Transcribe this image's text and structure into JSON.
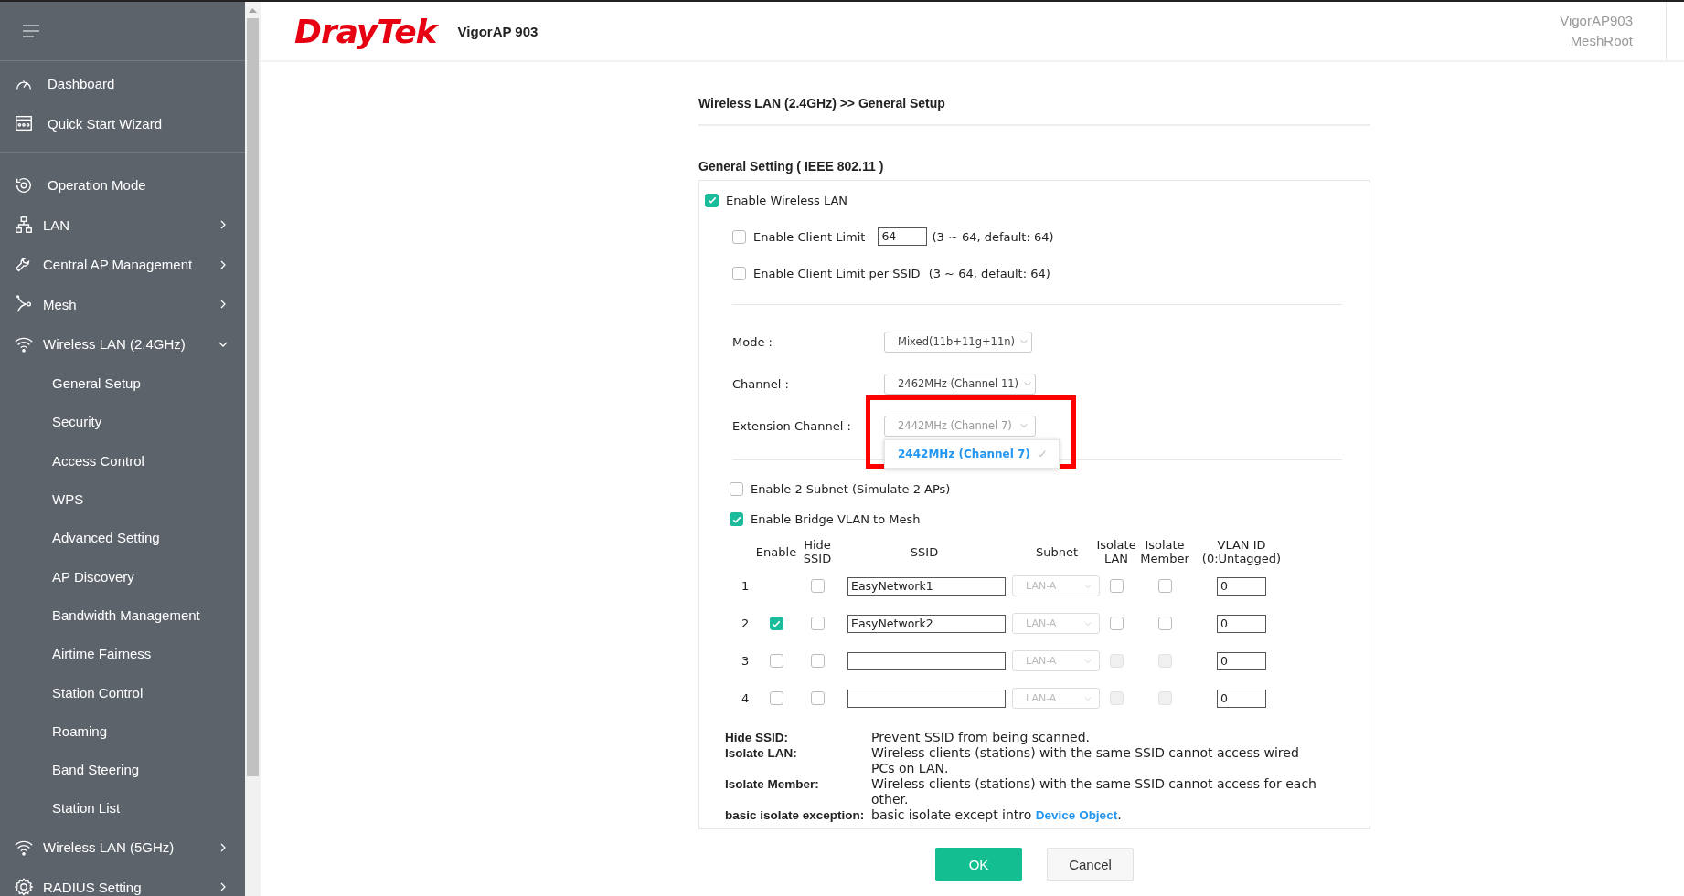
{
  "header": {
    "logo": "DrayTek",
    "model": "VigorAP 903",
    "device_name": "VigorAP903",
    "device_role": "MeshRoot"
  },
  "sidebar": {
    "sections": [
      [
        {
          "label": "Dashboard"
        },
        {
          "label": "Quick Start Wizard"
        }
      ],
      [
        {
          "label": "Operation Mode"
        },
        {
          "label": "LAN",
          "expanded": false
        },
        {
          "label": "Central AP Management",
          "expanded": false
        },
        {
          "label": "Mesh",
          "expanded": false
        },
        {
          "label": "Wireless LAN (2.4GHz)",
          "expanded": true,
          "children": [
            {
              "label": "General Setup"
            },
            {
              "label": "Security"
            },
            {
              "label": "Access Control"
            },
            {
              "label": "WPS"
            },
            {
              "label": "Advanced Setting"
            },
            {
              "label": "AP Discovery"
            },
            {
              "label": "Bandwidth Management"
            },
            {
              "label": "Airtime Fairness"
            },
            {
              "label": "Station Control"
            },
            {
              "label": "Roaming"
            },
            {
              "label": "Band Steering"
            },
            {
              "label": "Station List"
            }
          ]
        },
        {
          "label": "Wireless LAN (5GHz)",
          "expanded": false
        },
        {
          "label": "RADIUS Setting",
          "expanded": false
        }
      ]
    ]
  },
  "breadcrumb": "Wireless LAN (2.4GHz) >> General Setup",
  "section_title": "General Setting ( IEEE 802.11 )",
  "enable_wireless_lan": {
    "label": "Enable Wireless LAN",
    "checked": true
  },
  "client_limit": {
    "label": "Enable Client Limit",
    "checked": false,
    "value": "64",
    "hint": "(3 ~ 64, default: 64)"
  },
  "client_limit_per_ssid": {
    "label": "Enable Client Limit per SSID",
    "checked": false,
    "hint": "(3 ~ 64, default: 64)"
  },
  "selects": [
    {
      "label": "Mode :",
      "value": "Mixed(11b+11g+11n)",
      "open": false
    },
    {
      "label": "Channel :",
      "value": "2462MHz (Channel 11)",
      "open": false
    },
    {
      "label": "Extension Channel :",
      "value": "2442MHz (Channel 7)",
      "open": true,
      "options": [
        {
          "label": "2442MHz (Channel 7)",
          "selected": true
        }
      ]
    }
  ],
  "enable_2_subnet": {
    "label": "Enable 2 Subnet (Simulate 2 APs)",
    "checked": false
  },
  "bridge_vlan": {
    "label": "Enable Bridge VLAN to Mesh",
    "checked": true
  },
  "table": {
    "columns": [
      {},
      {
        "lines": [
          "Enable"
        ]
      },
      {
        "lines": [
          "Hide",
          "SSID"
        ]
      },
      {
        "lines": [
          "SSID"
        ]
      },
      {
        "lines": [
          "Subnet"
        ]
      },
      {
        "lines": [
          "Isolate",
          "LAN"
        ]
      },
      {
        "lines": [
          "Isolate",
          "Member"
        ]
      },
      {
        "lines": [
          "VLAN ID",
          "(0:Untagged)"
        ]
      }
    ],
    "rows": [
      {
        "index": "1",
        "hide_ssid": false,
        "ssid": "EasyNetwork1",
        "subnet": "LAN-A",
        "isolate_lan": false,
        "isolate_member": false,
        "isolate_disabled": false,
        "vlan_id": "0"
      },
      {
        "index": "2",
        "enable": true,
        "hide_ssid": false,
        "ssid": "EasyNetwork2",
        "subnet": "LAN-A",
        "isolate_lan": false,
        "isolate_member": false,
        "isolate_disabled": false,
        "vlan_id": "0"
      },
      {
        "index": "3",
        "enable": false,
        "hide_ssid": false,
        "subnet": "LAN-A",
        "isolate_lan": false,
        "isolate_member": false,
        "isolate_disabled": true,
        "vlan_id": "0"
      },
      {
        "index": "4",
        "enable": false,
        "hide_ssid": false,
        "subnet": "LAN-A",
        "isolate_lan": false,
        "isolate_member": false,
        "isolate_disabled": true,
        "vlan_id": "0"
      }
    ]
  },
  "notes": [
    {
      "term": "Hide SSID:",
      "text": "Prevent SSID from being scanned."
    },
    {
      "term": "Isolate LAN:",
      "text": "Wireless clients (stations) with the same SSID cannot access wired PCs on LAN."
    },
    {
      "term": "Isolate Member:",
      "text": "Wireless clients (stations) with the same SSID cannot access for each other."
    },
    {
      "term": "basic isolate exception:",
      "text": "basic isolate except intro",
      "link": "Device Object",
      "after": "."
    }
  ],
  "buttons": {
    "ok": "OK",
    "cancel": "Cancel"
  }
}
